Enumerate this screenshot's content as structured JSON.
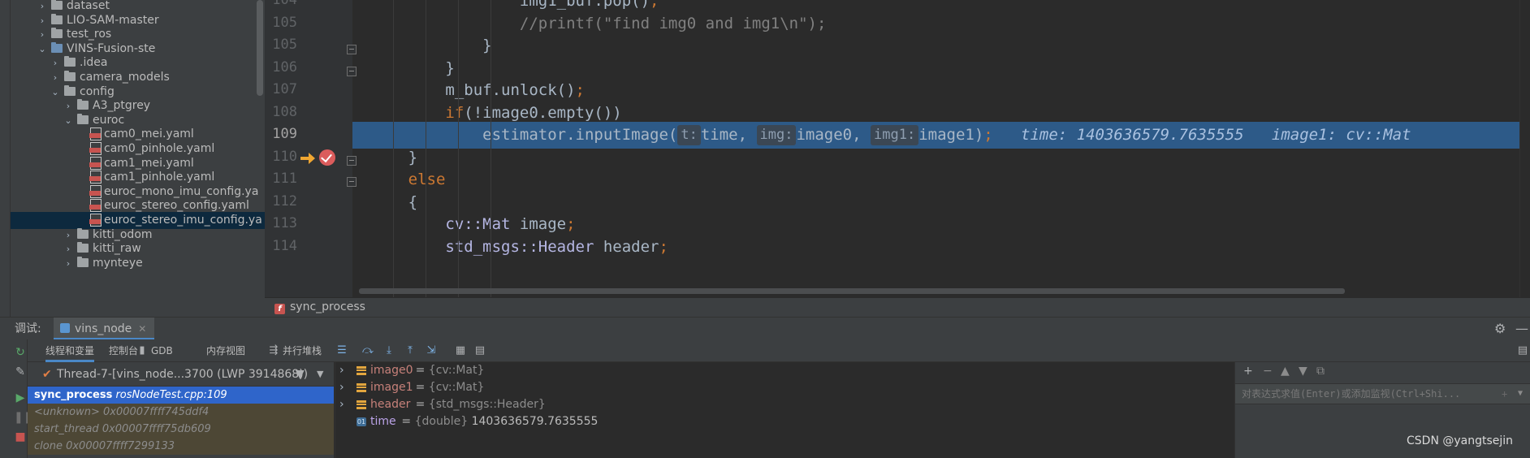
{
  "tree": {
    "rows": [
      {
        "label": "dataset",
        "kind": "folder",
        "depth": 0,
        "arrow": "right"
      },
      {
        "label": "LIO-SAM-master",
        "kind": "folder",
        "depth": 0,
        "arrow": "right"
      },
      {
        "label": "test_ros",
        "kind": "folder",
        "depth": 0,
        "arrow": "right"
      },
      {
        "label": "VINS-Fusion-ste",
        "kind": "module",
        "depth": 0,
        "arrow": "down"
      },
      {
        "label": ".idea",
        "kind": "folder",
        "depth": 1,
        "arrow": "right"
      },
      {
        "label": "camera_models",
        "kind": "folder",
        "depth": 1,
        "arrow": "right"
      },
      {
        "label": "config",
        "kind": "folder",
        "depth": 1,
        "arrow": "down"
      },
      {
        "label": "A3_ptgrey",
        "kind": "folder",
        "depth": 2,
        "arrow": "right"
      },
      {
        "label": "euroc",
        "kind": "folder",
        "depth": 2,
        "arrow": "down"
      },
      {
        "label": "cam0_mei.yaml",
        "kind": "yaml",
        "depth": 3,
        "arrow": ""
      },
      {
        "label": "cam0_pinhole.yaml",
        "kind": "yaml",
        "depth": 3,
        "arrow": ""
      },
      {
        "label": "cam1_mei.yaml",
        "kind": "yaml",
        "depth": 3,
        "arrow": ""
      },
      {
        "label": "cam1_pinhole.yaml",
        "kind": "yaml",
        "depth": 3,
        "arrow": ""
      },
      {
        "label": "euroc_mono_imu_config.ya",
        "kind": "yaml",
        "depth": 3,
        "arrow": ""
      },
      {
        "label": "euroc_stereo_config.yaml",
        "kind": "yaml",
        "depth": 3,
        "arrow": ""
      },
      {
        "label": "euroc_stereo_imu_config.ya",
        "kind": "yaml",
        "depth": 3,
        "arrow": "",
        "selected": true
      },
      {
        "label": "kitti_odom",
        "kind": "folder",
        "depth": 2,
        "arrow": "right"
      },
      {
        "label": "kitti_raw",
        "kind": "folder",
        "depth": 2,
        "arrow": "right"
      },
      {
        "label": "mynteye",
        "kind": "folder",
        "depth": 2,
        "arrow": "right"
      }
    ]
  },
  "editor": {
    "lines": [
      {
        "num": "104",
        "code": "img1_buf.pop();",
        "indent": 4
      },
      {
        "num": "105",
        "code": "//printf(\"find img0 and img1\\n\");",
        "indent": 4
      },
      {
        "num": "105",
        "code": "}",
        "indent": 3
      },
      {
        "num": "106",
        "code": "}",
        "indent": 2
      },
      {
        "num": "107",
        "code": "m_buf.unlock();",
        "indent": 2
      },
      {
        "num": "108",
        "code": "if(!image0.empty())",
        "indent": 2
      },
      {
        "num": "109",
        "code": "estimator.inputImage(",
        "indent": 3,
        "current": true
      },
      {
        "num": "110",
        "code": "}",
        "indent": 1
      },
      {
        "num": "111",
        "code": "else",
        "indent": 1
      },
      {
        "num": "112",
        "code": "{",
        "indent": 1
      },
      {
        "num": "113",
        "code": "cv::Mat image;",
        "indent": 2
      },
      {
        "num": "114",
        "code": "std_msgs::Header header;",
        "indent": 2
      }
    ],
    "current_line": {
      "call": "estimator.inputImage(",
      "hint_t": "t:",
      "arg_t": "time,",
      "hint_img": "img:",
      "arg_img": "image0,",
      "hint_img1": "img1:",
      "arg_img1": "image1);",
      "inline_1": "time: 1403636579.7635555",
      "inline_2": "image1: cv::Mat"
    },
    "breadcrumb": "sync_process",
    "breadcrumb_badge": "f"
  },
  "debug": {
    "label": "调试:",
    "session_tab": "vins_node",
    "tabs": [
      "线程和变量",
      "控制台",
      "GDB",
      "内存视图",
      "并行堆栈"
    ],
    "thread": "Thread-7-[vins_node...3700 (LWP 3914868))",
    "frames": [
      {
        "fn": "sync_process",
        "file": "rosNodeTest.cpp:109",
        "selected": true
      },
      {
        "fn": "<unknown>",
        "file": "0x00007ffff745ddf4"
      },
      {
        "fn": "start_thread",
        "file": "0x00007ffff75db609"
      },
      {
        "fn": "clone",
        "file": "0x00007ffff7299133"
      }
    ],
    "variables": [
      {
        "name": "image0",
        "type": "{cv::Mat}",
        "value": "",
        "kind": "obj"
      },
      {
        "name": "image1",
        "type": "{cv::Mat}",
        "value": "",
        "kind": "obj"
      },
      {
        "name": "header",
        "type": "{std_msgs::Header}",
        "value": "",
        "kind": "obj"
      },
      {
        "name": "time",
        "type": "{double}",
        "value": "1403636579.7635555",
        "kind": "prim"
      }
    ],
    "watch_placeholder": "对表达式求值(Enter)或添加监视(Ctrl+Shi..."
  },
  "watermark": "CSDN @yangtsejin",
  "icons": {
    "folder": "folder-icon",
    "yaml": "yaml-file-icon",
    "breakpoint": "breakpoint-icon",
    "exec_arrow": "execution-point-icon"
  }
}
